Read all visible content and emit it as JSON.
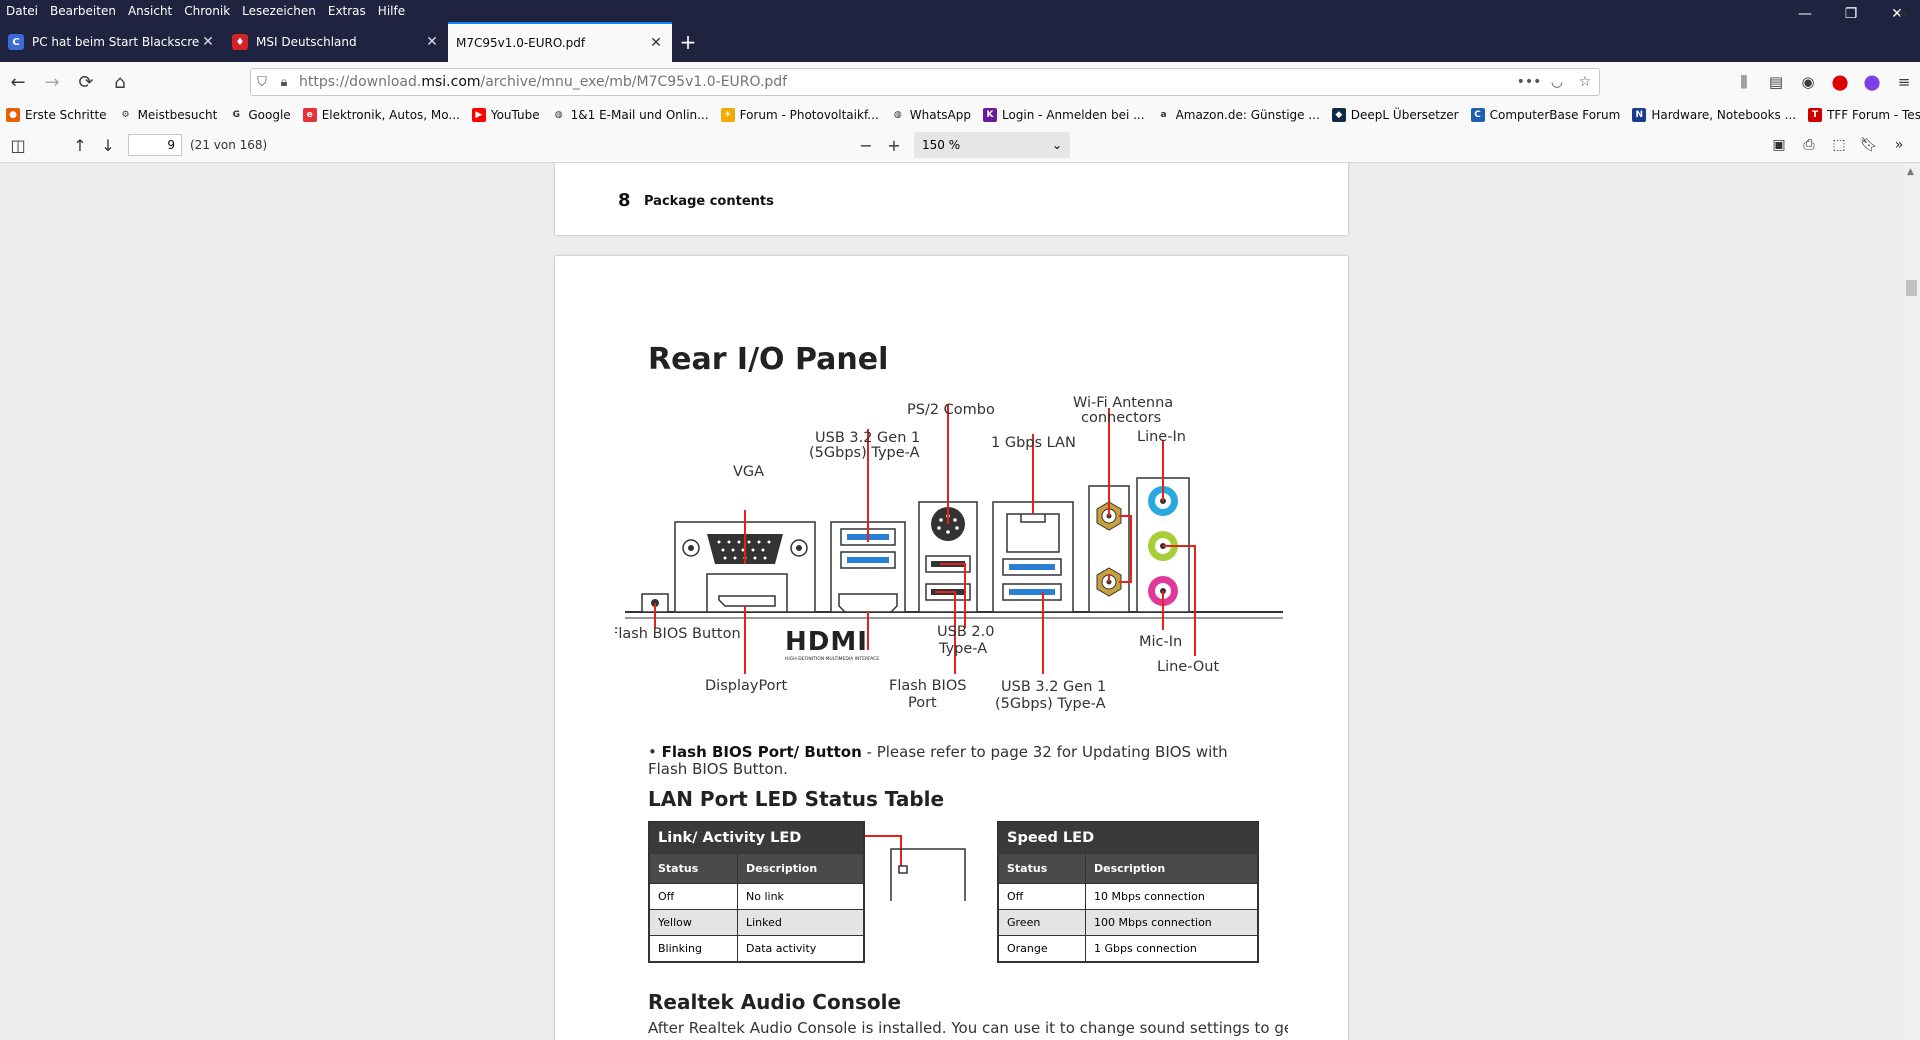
{
  "menu": [
    "Datei",
    "Bearbeiten",
    "Ansicht",
    "Chronik",
    "Lesezeichen",
    "Extras",
    "Hilfe"
  ],
  "window_controls": {
    "minimize": "—",
    "restore": "❐",
    "close": "✕"
  },
  "tabs": [
    {
      "label": "PC hat beim Start Blackscreen |",
      "favicon_color": "#3b6bd6",
      "favicon_text": "C"
    },
    {
      "label": "MSI Deutschland",
      "favicon_color": "#d2232a",
      "favicon_text": "♦"
    },
    {
      "label": "M7C95v1.0-EURO.pdf",
      "favicon_color": "",
      "favicon_text": ""
    }
  ],
  "url": {
    "prefix": "https://download.",
    "domain": "msi.com",
    "path": "/archive/mnu_exe/mb/M7C95v1.0-EURO.pdf"
  },
  "bookmarks": [
    {
      "label": "Erste Schritte",
      "color": "#e66000",
      "glyph": "●"
    },
    {
      "label": "Meistbesucht",
      "color": "",
      "glyph": "⚙"
    },
    {
      "label": "Google",
      "color": "",
      "glyph": "G"
    },
    {
      "label": "Elektronik, Autos, Mo...",
      "color": "#e53238",
      "glyph": "e"
    },
    {
      "label": "YouTube",
      "color": "#ff0000",
      "glyph": "▶"
    },
    {
      "label": "1&1 E-Mail und Onlin...",
      "color": "",
      "glyph": "◍"
    },
    {
      "label": "Forum - Photovoltaikf...",
      "color": "#f2a900",
      "glyph": "☀"
    },
    {
      "label": "WhatsApp",
      "color": "",
      "glyph": "◍"
    },
    {
      "label": "Login - Anmelden bei ...",
      "color": "#6a1b9a",
      "glyph": "K"
    },
    {
      "label": "Amazon.de: Günstige ...",
      "color": "",
      "glyph": "a"
    },
    {
      "label": "DeepL Übersetzer",
      "color": "#0f2b46",
      "glyph": "◆"
    },
    {
      "label": "ComputerBase Forum",
      "color": "#1e5fb4",
      "glyph": "C"
    },
    {
      "label": "Hardware, Notebooks ...",
      "color": "#1a3d8f",
      "glyph": "N"
    },
    {
      "label": "TFF Forum - Tesla Fahr...",
      "color": "#cc0000",
      "glyph": "T"
    }
  ],
  "pdf": {
    "page": "9",
    "page_count": "(21 von 168)",
    "zoom": "150 %"
  },
  "page1": {
    "number": "8",
    "title": "Package contents"
  },
  "page2": {
    "title": "Rear I/O Panel",
    "labels": {
      "ps2": "PS/2 Combo",
      "wifi1": "Wi-Fi Antenna",
      "wifi2": "connectors",
      "usb32a1": "USB 3.2 Gen 1",
      "usb32a2": "(5Gbps) Type-A",
      "lan": "1 Gbps LAN",
      "linein": "Line-In",
      "vga": "VGA",
      "flashbtn": "Flash BIOS Button",
      "dp": "DisplayPort",
      "usb20a": "USB 2.0",
      "usb20b": "Type-A",
      "flashport1": "Flash BIOS",
      "flashport2": "Port",
      "usb32b1": "USB 3.2 Gen 1",
      "usb32b2": "(5Gbps) Type-A",
      "micin": "Mic-In",
      "lineout": "Line-Out",
      "hdmi": "HDMI",
      "hdmi_sub": "HIGH-DEFINITION MULTIMEDIA INTERFACE"
    },
    "note_bold": "Flash BIOS Port/ Button",
    "note_text": " - Please refer to page 32 for Updating BIOS with Flash BIOS Button.",
    "lan_heading": "LAN Port LED Status Table",
    "link_table": {
      "title": "Link/ Activity LED",
      "headers": [
        "Status",
        "Description"
      ],
      "rows": [
        [
          "Off",
          "No link"
        ],
        [
          "Yellow",
          "Linked"
        ],
        [
          "Blinking",
          "Data activity"
        ]
      ]
    },
    "speed_table": {
      "title": "Speed LED",
      "headers": [
        "Status",
        "Description"
      ],
      "rows": [
        [
          "Off",
          "10 Mbps connection"
        ],
        [
          "Green",
          "100 Mbps connection"
        ],
        [
          "Orange",
          "1 Gbps connection"
        ]
      ]
    },
    "audio_heading": "Realtek Audio Console",
    "audio_text": "After Realtek Audio Console is installed. You can use it to change sound settings to get"
  },
  "colors": {
    "accent": "#e2231a",
    "usb3": "#2a7fd4",
    "audio_blue": "#2aa8e0",
    "audio_green": "#a6ce39",
    "audio_pink": "#e0399a",
    "antenna": "#c8a040"
  }
}
